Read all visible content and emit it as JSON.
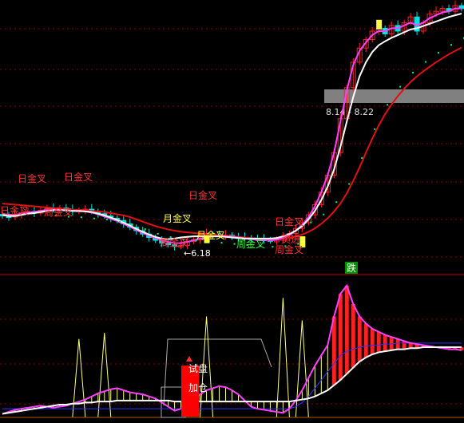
{
  "colors": {
    "background": "#000000",
    "grid": "#8b0000",
    "divider": "#c00000",
    "up": "#ff2020",
    "down": "#00e0e0",
    "ma_white": "#ffffff",
    "ma_magenta": "#ff40ff",
    "ma_red": "#e01010",
    "dots": "#00ff66",
    "label_red": "#ff3030",
    "label_yellow": "#ffff40",
    "label_green": "#30ff30",
    "band": "#808080",
    "cyan_seg": "#00ffff",
    "osc_yellow": "#ffff80",
    "osc_blue": "#3030ff"
  },
  "annotations": {
    "price_range": "8.14 - 8.22",
    "low_price": "6.18",
    "fall": "跌",
    "trial": "试盘",
    "add": "加仓",
    "ri_golden_cross": "日金叉",
    "zhou_golden_cross": "周金叉",
    "yue_golden_cross": "月金叉",
    "buy_entry": "买进"
  },
  "chart_data": [
    {
      "type": "candlestick",
      "panel": "main",
      "grid": true,
      "x": [
        0,
        1,
        2,
        3,
        4,
        5,
        6,
        7,
        8,
        9,
        10,
        11,
        12,
        13,
        14,
        15,
        16,
        17,
        18,
        19,
        20,
        21,
        22,
        23,
        24,
        25,
        26,
        27,
        28,
        29,
        30,
        31,
        32,
        33,
        34,
        35,
        36,
        37,
        38,
        39,
        40,
        41,
        42,
        43,
        44,
        45,
        46,
        47,
        48,
        49,
        50,
        51,
        52,
        53,
        54,
        55,
        56,
        57,
        58,
        59,
        60,
        61,
        62,
        63,
        64,
        65,
        66,
        67,
        68,
        69,
        70,
        71,
        72
      ],
      "series": [
        {
          "key": "close",
          "values": [
            6.78,
            6.76,
            6.8,
            6.84,
            6.86,
            6.83,
            6.88,
            6.91,
            6.89,
            6.92,
            6.89,
            6.86,
            6.88,
            6.9,
            6.86,
            6.82,
            6.78,
            6.74,
            6.7,
            6.64,
            6.58,
            6.52,
            6.46,
            6.4,
            6.35,
            6.3,
            6.27,
            6.24,
            6.26,
            6.33,
            6.36,
            6.44,
            6.46,
            6.45,
            6.43,
            6.44,
            6.41,
            6.4,
            6.39,
            6.38,
            6.37,
            6.36,
            6.34,
            6.35,
            6.4,
            6.47,
            6.56,
            6.66,
            6.8,
            6.98,
            7.2,
            7.5,
            7.9,
            8.5,
            9.05,
            9.5,
            9.75,
            9.9,
            10.05,
            10.1,
            10.0,
            10.15,
            10.05,
            10.2,
            10.3,
            10.05,
            10.2,
            10.35,
            10.4,
            10.45,
            10.4,
            10.5,
            10.45
          ]
        },
        {
          "key": "ma_white",
          "values": [
            6.8,
            6.78,
            6.78,
            6.8,
            6.82,
            6.83,
            6.85,
            6.87,
            6.88,
            6.88,
            6.88,
            6.87,
            6.87,
            6.86,
            6.85,
            6.82,
            6.79,
            6.75,
            6.71,
            6.66,
            6.61,
            6.55,
            6.5,
            6.45,
            6.41,
            6.38,
            6.37,
            6.38,
            6.4,
            6.41,
            6.42,
            6.42,
            6.42,
            6.42,
            6.42,
            6.41,
            6.4,
            6.39,
            6.38,
            6.38,
            6.38,
            6.38,
            6.38,
            6.39,
            6.42,
            6.46,
            6.52,
            6.6,
            6.72,
            6.87,
            7.06,
            7.3,
            7.6,
            8.0,
            8.45,
            8.88,
            9.25,
            9.5,
            9.68,
            9.8,
            9.87,
            9.93,
            9.98,
            10.03,
            10.08,
            10.1,
            10.14,
            10.18,
            10.22,
            10.26,
            10.3,
            10.33,
            10.36
          ]
        },
        {
          "key": "ma_magenta",
          "values": [
            6.82,
            6.8,
            6.8,
            6.82,
            6.84,
            6.85,
            6.87,
            6.89,
            6.89,
            6.89,
            6.88,
            6.87,
            6.87,
            6.86,
            6.84,
            6.81,
            6.77,
            6.73,
            6.69,
            6.64,
            6.59,
            6.53,
            6.48,
            6.43,
            6.39,
            6.35,
            6.32,
            6.3,
            6.3,
            6.32,
            6.35,
            6.38,
            6.4,
            6.42,
            6.42,
            6.42,
            6.41,
            6.4,
            6.38,
            6.37,
            6.36,
            6.36,
            6.35,
            6.36,
            6.39,
            6.44,
            6.52,
            6.62,
            6.76,
            6.95,
            7.2,
            7.5,
            7.9,
            8.45,
            9.0,
            9.45,
            9.7,
            9.85,
            9.98,
            10.05,
            10.05,
            10.1,
            10.1,
            10.15,
            10.2,
            10.15,
            10.2,
            10.28,
            10.33,
            10.38,
            10.4,
            10.45,
            10.45
          ]
        },
        {
          "key": "ma_red",
          "values": [
            7.0,
            6.99,
            6.98,
            6.97,
            6.96,
            6.95,
            6.94,
            6.93,
            6.92,
            6.91,
            6.9,
            6.89,
            6.89,
            6.88,
            6.87,
            6.86,
            6.85,
            6.83,
            6.81,
            6.79,
            6.76,
            6.72,
            6.68,
            6.64,
            6.6,
            6.57,
            6.54,
            6.52,
            6.5,
            6.49,
            6.48,
            6.47,
            6.46,
            6.45,
            6.44,
            6.43,
            6.42,
            6.41,
            6.4,
            6.39,
            6.38,
            6.37,
            6.37,
            6.37,
            6.38,
            6.39,
            6.42,
            6.45,
            6.5,
            6.56,
            6.64,
            6.74,
            6.86,
            7.0,
            7.18,
            7.4,
            7.64,
            7.9,
            8.15,
            8.38,
            8.58,
            8.75,
            8.9,
            9.03,
            9.15,
            9.25,
            9.34,
            9.42,
            9.5,
            9.57,
            9.64,
            9.7,
            9.76
          ]
        }
      ],
      "ylim": [
        5.8,
        10.6
      ]
    },
    {
      "type": "bar",
      "panel": "indicator",
      "grid": true,
      "x": [
        0,
        1,
        2,
        3,
        4,
        5,
        6,
        7,
        8,
        9,
        10,
        11,
        12,
        13,
        14,
        15,
        16,
        17,
        18,
        19,
        20,
        21,
        22,
        23,
        24,
        25,
        26,
        27,
        28,
        29,
        30,
        31,
        32,
        33,
        34,
        35,
        36,
        37,
        38,
        39,
        40,
        41,
        42,
        43,
        44,
        45,
        46,
        47,
        48,
        49,
        50,
        51,
        52,
        53,
        54,
        55,
        56,
        57,
        58,
        59,
        60,
        61,
        62,
        63,
        64,
        65,
        66,
        67,
        68,
        69,
        70,
        71,
        72
      ],
      "series": [
        {
          "key": "osc_magenta",
          "values": [
            5,
            7,
            9,
            10,
            11,
            12,
            13,
            12,
            11,
            12,
            13,
            15,
            17,
            19,
            22,
            25,
            27,
            29,
            30,
            28,
            26,
            25,
            24,
            22,
            20,
            16,
            12,
            8,
            10,
            14,
            20,
            24,
            28,
            30,
            32,
            31,
            28,
            24,
            18,
            12,
            10,
            9,
            8,
            7,
            6,
            10,
            18,
            28,
            40,
            52,
            62,
            72,
            100,
            122,
            130,
            112,
            100,
            93,
            88,
            85,
            82,
            80,
            78,
            76,
            74,
            73,
            72,
            71,
            70,
            69,
            68,
            68,
            67
          ]
        },
        {
          "key": "osc_white",
          "values": [
            5,
            6,
            7,
            8,
            9,
            10,
            11,
            12,
            13,
            14,
            14,
            15,
            15,
            16,
            16,
            17,
            17,
            17,
            18,
            18,
            18,
            18,
            18,
            18,
            18,
            18,
            18,
            17,
            17,
            17,
            17,
            17,
            17,
            17,
            17,
            17,
            17,
            17,
            17,
            17,
            17,
            17,
            17,
            17,
            17,
            17,
            18,
            19,
            20,
            22,
            25,
            28,
            33,
            38,
            44,
            50,
            56,
            60,
            63,
            65,
            66,
            67,
            68,
            68,
            69,
            69,
            70,
            70,
            70,
            70,
            70,
            70,
            70
          ]
        },
        {
          "key": "osc_blue",
          "values": [
            10,
            10,
            10,
            10,
            10,
            10,
            10,
            10,
            10,
            10,
            10,
            10,
            10,
            10,
            10,
            10,
            10,
            10,
            10,
            10,
            10,
            10,
            10,
            10,
            10,
            10,
            10,
            10,
            10,
            10,
            10,
            10,
            10,
            10,
            10,
            10,
            10,
            10,
            10,
            10,
            10,
            10,
            10,
            10,
            10,
            10,
            12,
            16,
            22,
            30,
            38,
            46,
            54,
            62,
            66,
            68,
            70,
            71,
            72,
            72,
            73,
            73,
            74,
            74,
            74,
            74,
            74,
            74,
            74,
            74,
            74,
            74,
            74
          ]
        }
      ],
      "ylim": [
        0,
        140
      ]
    }
  ]
}
